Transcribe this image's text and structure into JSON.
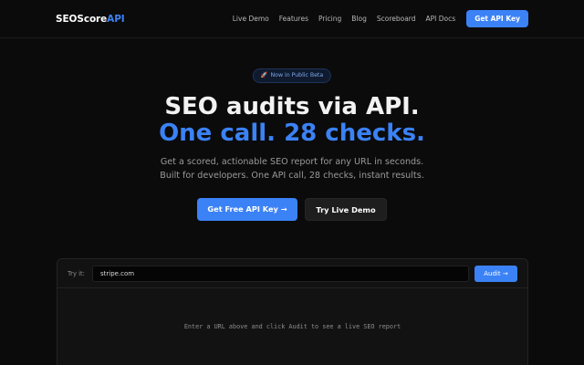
{
  "nav": {
    "logo_main": "SEOScore",
    "logo_accent": "API",
    "links": [
      "Live Demo",
      "Features",
      "Pricing",
      "Blog",
      "Scoreboard",
      "API Docs"
    ],
    "cta": "Get API Key"
  },
  "hero": {
    "badge_icon": "🚀",
    "badge": "Now in Public Beta",
    "title_line1": "SEO audits via API.",
    "title_line2": "One call. 28 checks.",
    "subtitle_line1": "Get a scored, actionable SEO report for any URL in seconds.",
    "subtitle_line2": "Built for developers. One API call, 28 checks, instant results.",
    "primary_button": "Get Free API Key →",
    "secondary_button": "Try Live Demo"
  },
  "demo": {
    "label": "Try it:",
    "input_value": "stripe.com",
    "audit_button": "Audit →",
    "placeholder_message": "Enter a URL above and click Audit to see a live SEO report"
  },
  "colors": {
    "accent": "#3b82f6",
    "background": "#0b0b0b"
  }
}
